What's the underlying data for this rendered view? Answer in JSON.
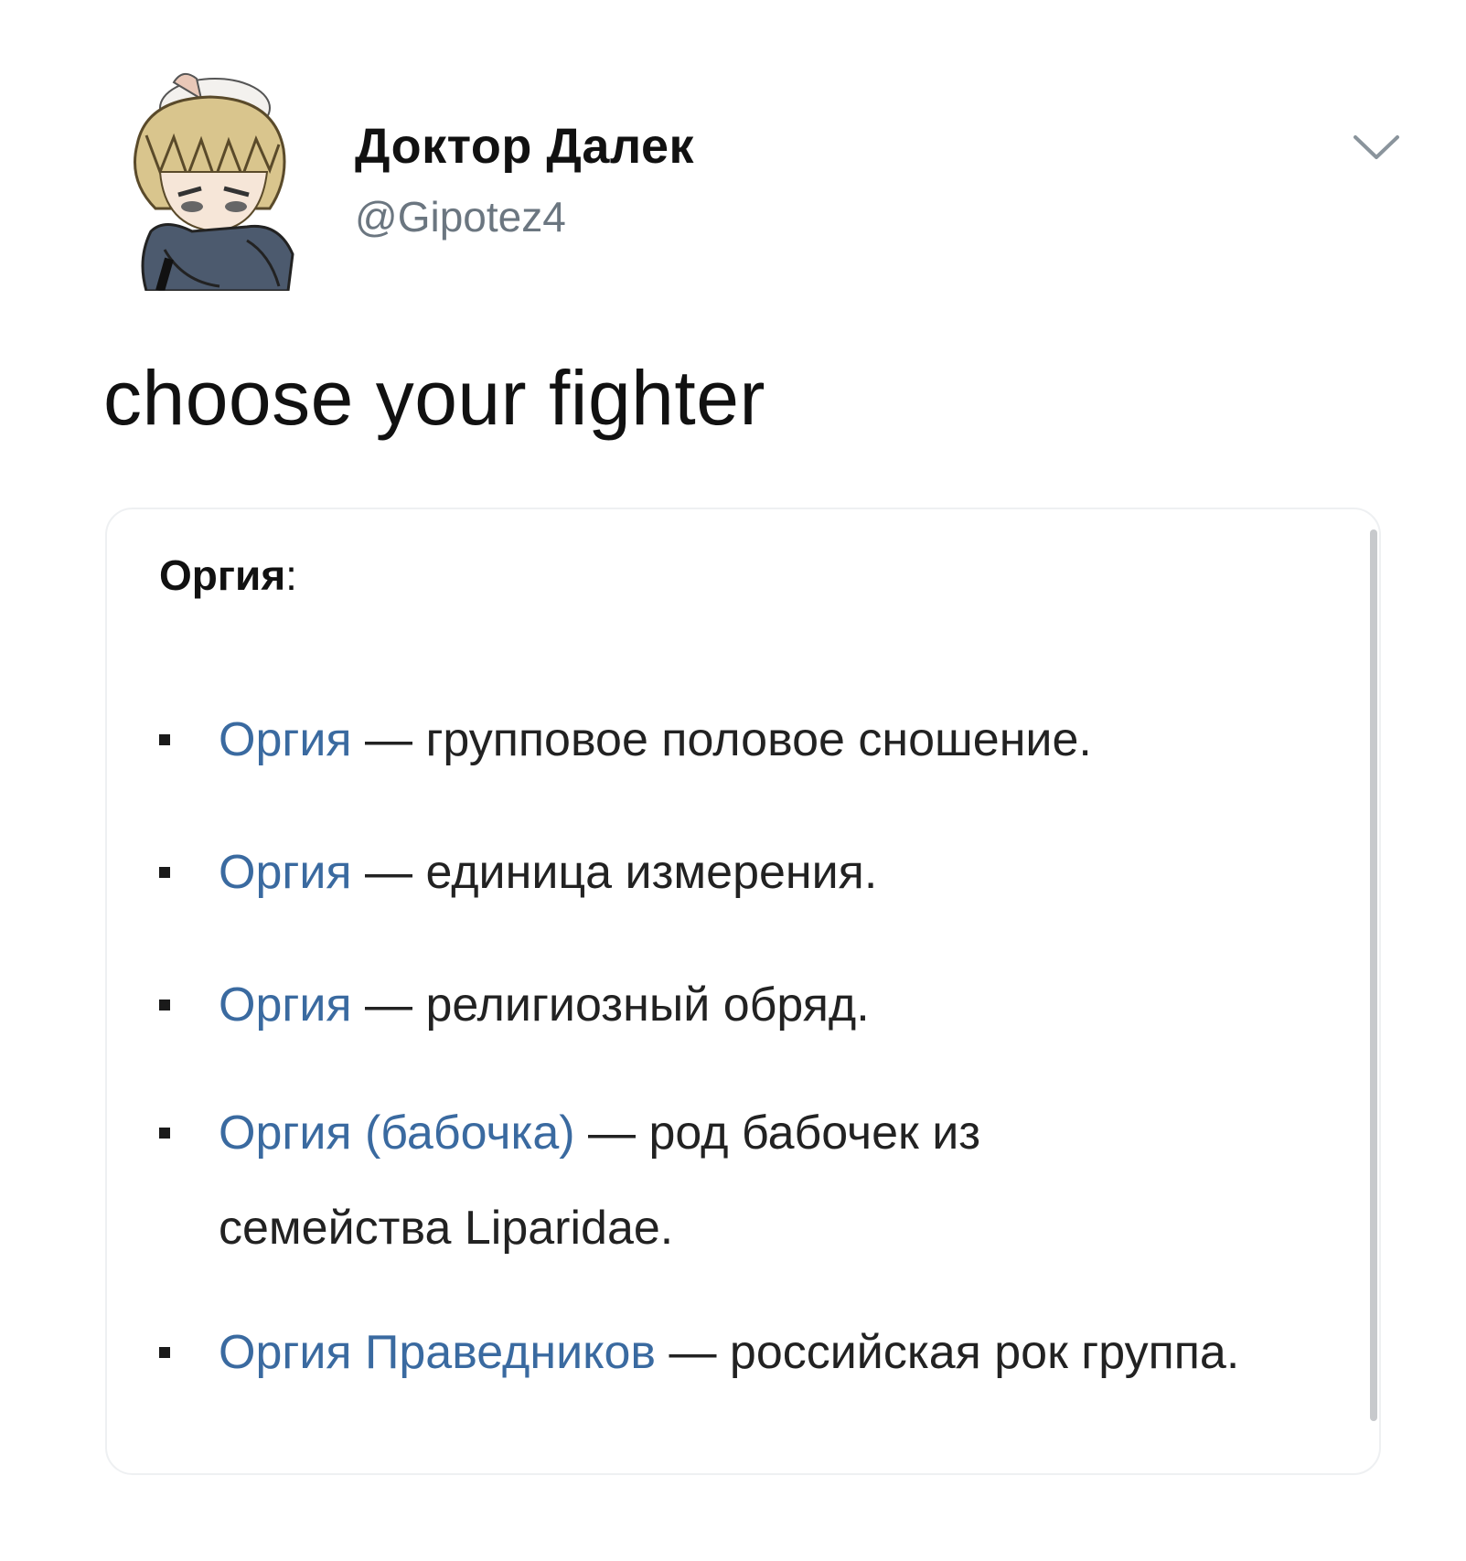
{
  "header": {
    "display_name": "Доктор Далек",
    "handle": "@Gipotez4",
    "avatar_icon": "anime-character-avatar",
    "menu_icon": "chevron-down-icon"
  },
  "tweet": {
    "text": "choose your fighter"
  },
  "card": {
    "title": "Оргия",
    "title_suffix": ":",
    "items": [
      {
        "link": "Оргия",
        "text": " — групповое половое сношение."
      },
      {
        "link": "Оргия",
        "text": " — единица измерения."
      },
      {
        "link": "Оргия",
        "text": " — религиозный обряд."
      },
      {
        "link": "Оргия (бабочка)",
        "text": " — род бабочек из семейства Liparidae."
      },
      {
        "link": "Оргия Праведников",
        "text": " — российская рок группа."
      }
    ]
  },
  "colors": {
    "link": "#3a6aa0",
    "handle": "#6b7680",
    "text": "#111111"
  }
}
